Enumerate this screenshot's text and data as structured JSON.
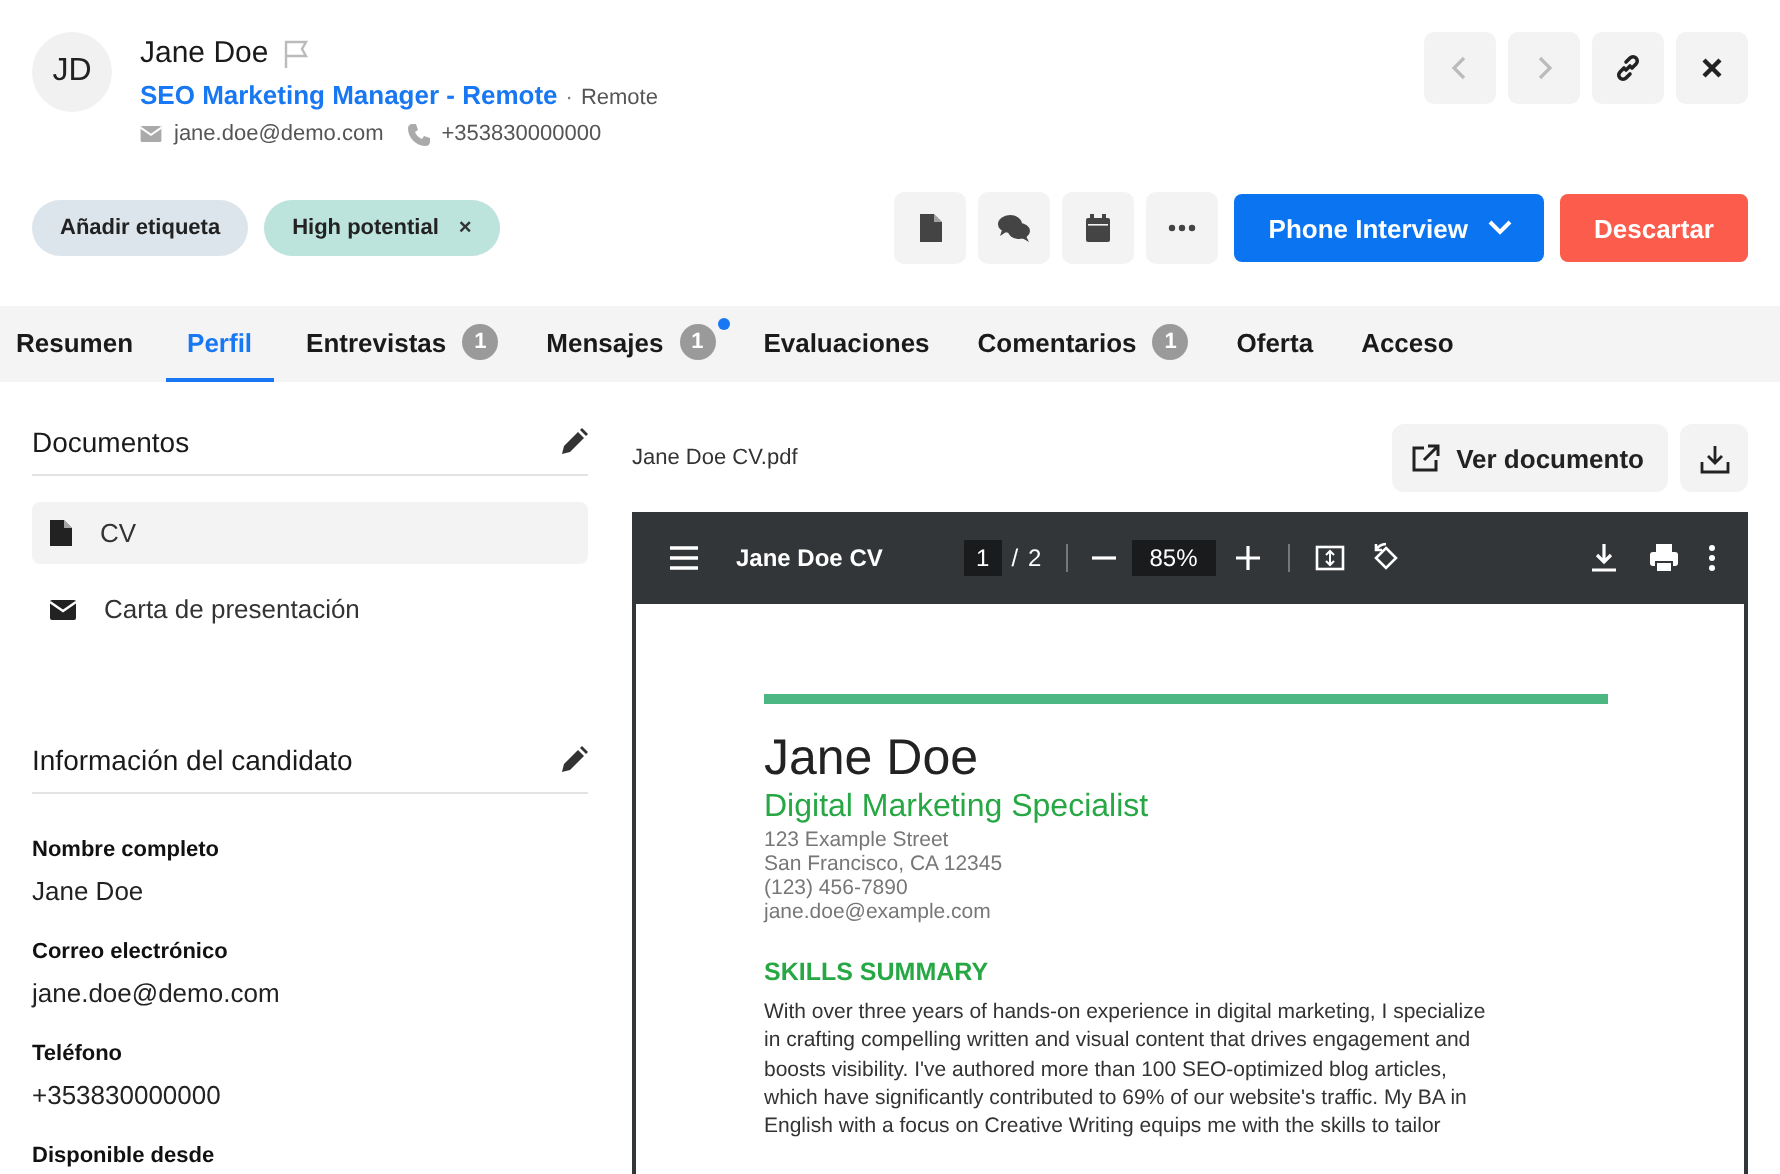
{
  "candidate": {
    "initials": "JD",
    "name": "Jane Doe",
    "flagged": false,
    "job_title": "SEO Marketing Manager - Remote",
    "separator": "·",
    "location": "Remote",
    "email": "jane.doe@demo.com",
    "phone": "+353830000000"
  },
  "nav_buttons": [
    {
      "kind": "prev",
      "disabled": true
    },
    {
      "kind": "next",
      "disabled": true
    },
    {
      "kind": "link",
      "disabled": false
    },
    {
      "kind": "close",
      "disabled": false
    }
  ],
  "tags": [
    {
      "label": "Añadir etiqueta",
      "kind": "add"
    },
    {
      "label": "High potential",
      "kind": "tag",
      "remove_icon": "×"
    }
  ],
  "actions": {
    "icon_buttons": [
      {
        "kind": "document"
      },
      {
        "kind": "chat"
      },
      {
        "kind": "calendar"
      },
      {
        "kind": "more"
      }
    ],
    "stage": "Phone Interview",
    "discard": "Descartar"
  },
  "tabs": [
    {
      "label": "Resumen",
      "selected": false
    },
    {
      "label": "Perfil",
      "selected": true
    },
    {
      "label": "Entrevistas",
      "count": "1",
      "selected": false
    },
    {
      "label": "Mensajes",
      "count": "1",
      "unread": true,
      "selected": false
    },
    {
      "label": "Evaluaciones",
      "selected": false
    },
    {
      "label": "Comentarios",
      "count": "1",
      "selected": false
    },
    {
      "label": "Oferta",
      "selected": false
    },
    {
      "label": "Acceso",
      "selected": false
    }
  ],
  "documents": {
    "title": "Documentos",
    "items": [
      {
        "label": "CV",
        "kind": "file",
        "selected": true
      },
      {
        "label": "Carta de presentación",
        "kind": "letter",
        "selected": false
      }
    ]
  },
  "candidate_info": {
    "title": "Información del candidato",
    "fields": [
      {
        "label": "Nombre completo",
        "value": "Jane Doe"
      },
      {
        "label": "Correo electrónico",
        "value": "jane.doe@demo.com"
      },
      {
        "label": "Teléfono",
        "value": "+353830000000"
      },
      {
        "label": "Disponible desde"
      }
    ]
  },
  "viewer": {
    "filename": "Jane Doe CV.pdf",
    "open_button": "Ver documento",
    "toolbar": {
      "title": "Jane Doe CV",
      "page": "1",
      "page_separator": "/",
      "pages": "2",
      "zoom": "85%"
    },
    "document": {
      "name": "Jane Doe",
      "headline": "Digital Marketing Specialist",
      "contact": [
        "123 Example Street",
        "San Francisco, CA 12345",
        "(123) 456-7890",
        "jane.doe@example.com"
      ],
      "section_title": "SKILLS SUMMARY",
      "summary_lines": [
        "With over three years of hands-on experience in digital marketing, I specialize",
        "in crafting compelling written and visual content that drives engagement and",
        "boosts visibility. I've authored more than 100 SEO-optimized blog articles,",
        "which have significantly contributed to 69% of our website's traffic. My BA in",
        "English with a focus on Creative Writing equips me with the skills to tailor"
      ]
    }
  }
}
